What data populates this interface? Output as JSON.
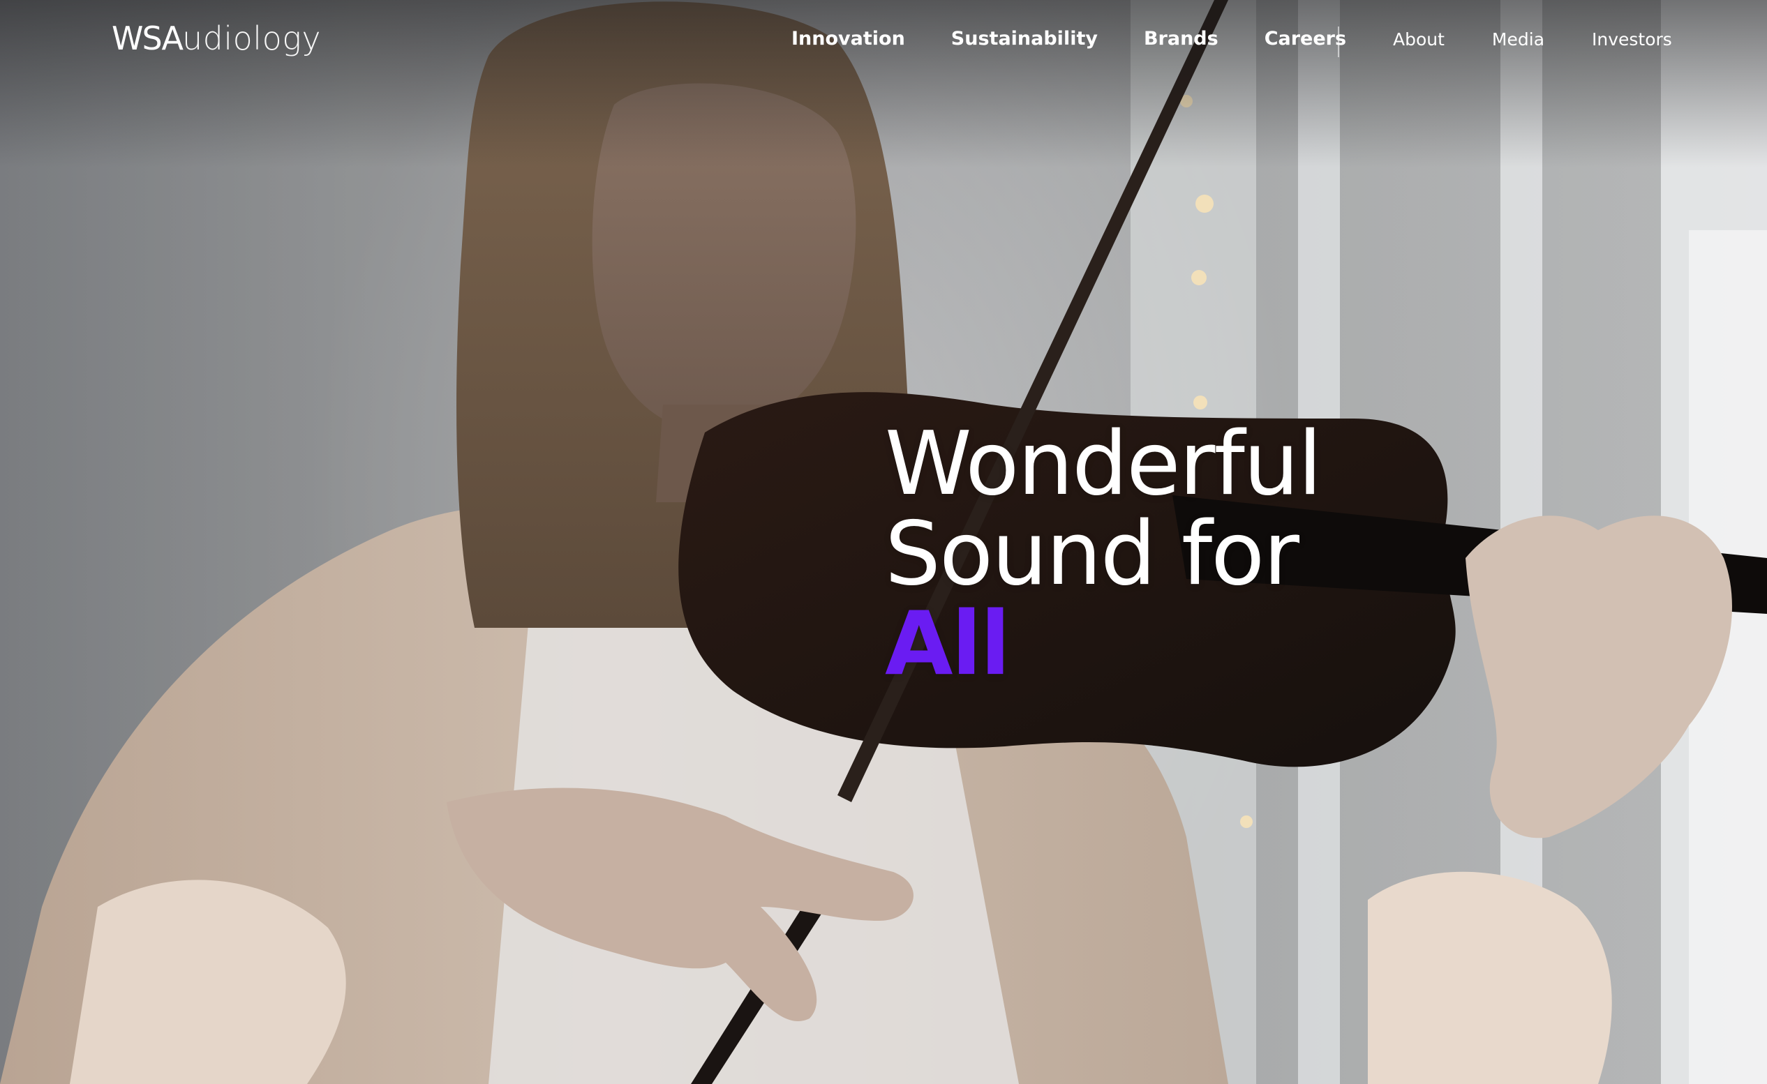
{
  "header": {
    "logo": {
      "strong": "WSA",
      "light": "udiology"
    },
    "primary_nav": [
      {
        "label": "Innovation"
      },
      {
        "label": "Sustainability"
      },
      {
        "label": "Brands"
      },
      {
        "label": "Careers"
      }
    ],
    "secondary_nav": [
      {
        "label": "About"
      },
      {
        "label": "Media"
      },
      {
        "label": "Investors"
      }
    ]
  },
  "hero": {
    "headline_line1": "Wonderful",
    "headline_line2": "Sound for",
    "headline_accent": "All"
  },
  "colors": {
    "accent": "#6a1cf2",
    "nav_text": "#ffffff"
  }
}
